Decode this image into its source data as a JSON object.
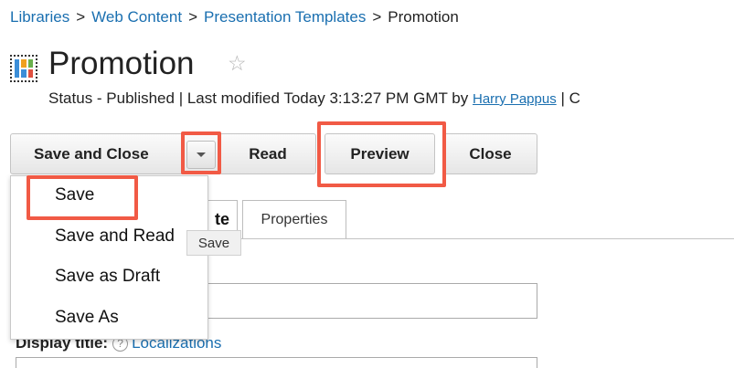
{
  "breadcrumb": {
    "items": [
      "Libraries",
      "Web Content",
      "Presentation Templates"
    ],
    "current": "Promotion",
    "separator": ">"
  },
  "header": {
    "title": "Promotion",
    "status_prefix": "Status - Published | Last modified Today 3:13:27 PM GMT by",
    "author": "Harry Pappus",
    "status_suffix": "| C"
  },
  "toolbar": {
    "save_and_close_label": "Save and Close",
    "read_label": "Read",
    "preview_label": "Preview",
    "close_label": "Close"
  },
  "dropdown_menu": {
    "items": [
      "Save",
      "Save and Read",
      "Save as Draft",
      "Save As"
    ],
    "tooltip": "Save"
  },
  "tabs": [
    {
      "label": "te"
    },
    {
      "label": "Properties"
    }
  ],
  "form": {
    "display_title_label": "Display title:",
    "help_icon": "?",
    "localizations_link": "Localizations"
  },
  "colors": {
    "link": "#1a6fb0",
    "highlight": "#f15a45"
  }
}
